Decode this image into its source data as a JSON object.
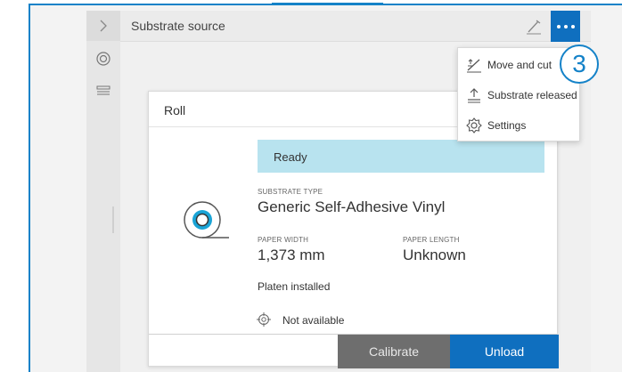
{
  "header": {
    "title": "Substrate source",
    "collapse_icon": "chevron-right-icon",
    "edit_icon": "edit-pencil-icon",
    "more_icon": "more-dots-icon"
  },
  "sidebar": {
    "items": [
      {
        "icon": "roll-icon"
      },
      {
        "icon": "stack-icon"
      }
    ]
  },
  "card": {
    "title": "Roll",
    "status": "Ready",
    "substrate_type_label": "SUBSTRATE TYPE",
    "substrate_type_value": "Generic Self-Adhesive Vinyl",
    "paper_width_label": "PAPER WIDTH",
    "paper_width_value": "1,373 mm",
    "paper_length_label": "PAPER LENGTH",
    "paper_length_value": "Unknown",
    "platen_text": "Platen installed",
    "availability_text": "Not available",
    "calibrate_label": "Calibrate",
    "unload_label": "Unload"
  },
  "menu": {
    "items": [
      {
        "label": "Move and cut",
        "icon": "move-cut-icon"
      },
      {
        "label": "Substrate released",
        "icon": "substrate-release-icon"
      },
      {
        "label": "Settings",
        "icon": "gear-icon"
      }
    ]
  },
  "callout": {
    "number": "3"
  },
  "colors": {
    "accent": "#0f6fbf",
    "status_banner": "#b8e3ef",
    "calibrate_button": "#6e6e6e",
    "frame_border": "#1482c8"
  }
}
